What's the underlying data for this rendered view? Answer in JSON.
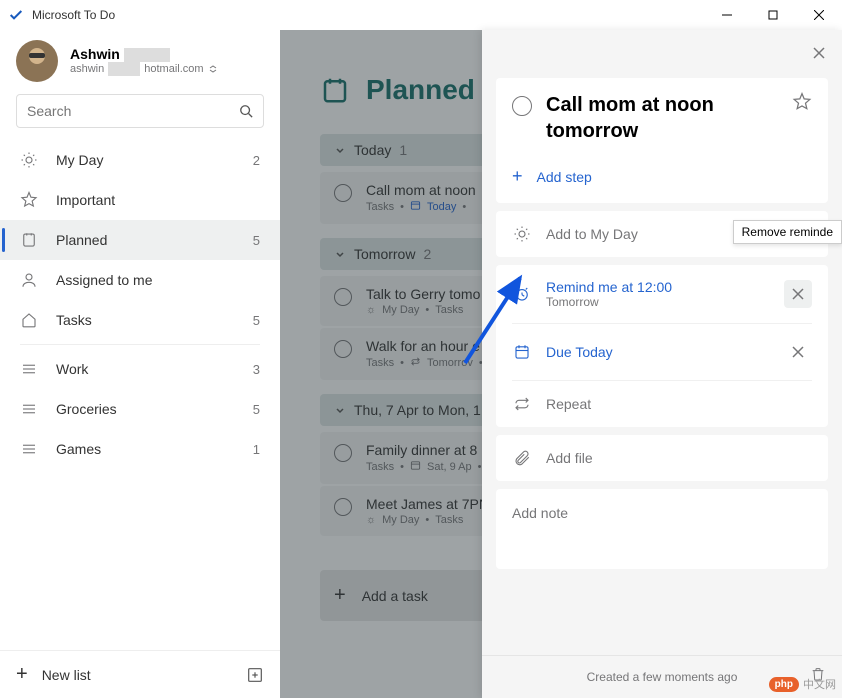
{
  "window": {
    "title": "Microsoft To Do"
  },
  "profile": {
    "name": "Ashwin",
    "email_prefix": "ashwin",
    "email_suffix": "hotmail.com"
  },
  "search": {
    "placeholder": "Search"
  },
  "sidebar": {
    "items": [
      {
        "icon": "sun",
        "label": "My Day",
        "count": "2"
      },
      {
        "icon": "star",
        "label": "Important",
        "count": ""
      },
      {
        "icon": "planned",
        "label": "Planned",
        "count": "5",
        "active": true
      },
      {
        "icon": "user",
        "label": "Assigned to me",
        "count": ""
      },
      {
        "icon": "home",
        "label": "Tasks",
        "count": "5"
      }
    ],
    "lists": [
      {
        "label": "Work",
        "count": "3"
      },
      {
        "label": "Groceries",
        "count": "5"
      },
      {
        "label": "Games",
        "count": "1"
      }
    ]
  },
  "newlist": {
    "label": "New list"
  },
  "main": {
    "title": "Planned",
    "groups": [
      {
        "label": "Today",
        "count": "1",
        "tasks": [
          {
            "title": "Call mom at noon",
            "meta_list": "Tasks",
            "meta_date": "Today",
            "date_icon": "calendar",
            "date_blue": true
          }
        ]
      },
      {
        "label": "Tomorrow",
        "count": "2",
        "tasks": [
          {
            "title": "Talk to Gerry tomo",
            "meta_sun": true,
            "meta_list": "My Day",
            "meta_extra": "Tasks"
          },
          {
            "title": "Walk for an hour e",
            "meta_list": "Tasks",
            "meta_date": "Tomorrov",
            "date_icon": "repeat"
          }
        ]
      },
      {
        "label": "Thu, 7 Apr to Mon, 1",
        "count": "",
        "tasks": [
          {
            "title": "Family dinner at 8",
            "meta_list": "Tasks",
            "meta_date": "Sat, 9 Ap",
            "date_icon": "calendar"
          },
          {
            "title": "Meet James at 7PN",
            "meta_sun": true,
            "meta_list": "My Day",
            "meta_extra": "Tasks"
          }
        ]
      }
    ],
    "add_task": "Add a task"
  },
  "detail": {
    "title": "Call mom at noon tomorrow",
    "add_step": "Add step",
    "add_to_my_day": "Add to My Day",
    "reminder": {
      "label": "Remind me at 12:00",
      "sub": "Tomorrow"
    },
    "due": "Due Today",
    "repeat": "Repeat",
    "add_file": "Add file",
    "add_note": "Add note",
    "created": "Created a few moments ago"
  },
  "tooltip": "Remove reminde",
  "watermark": {
    "badge": "php",
    "text": "中文网"
  }
}
